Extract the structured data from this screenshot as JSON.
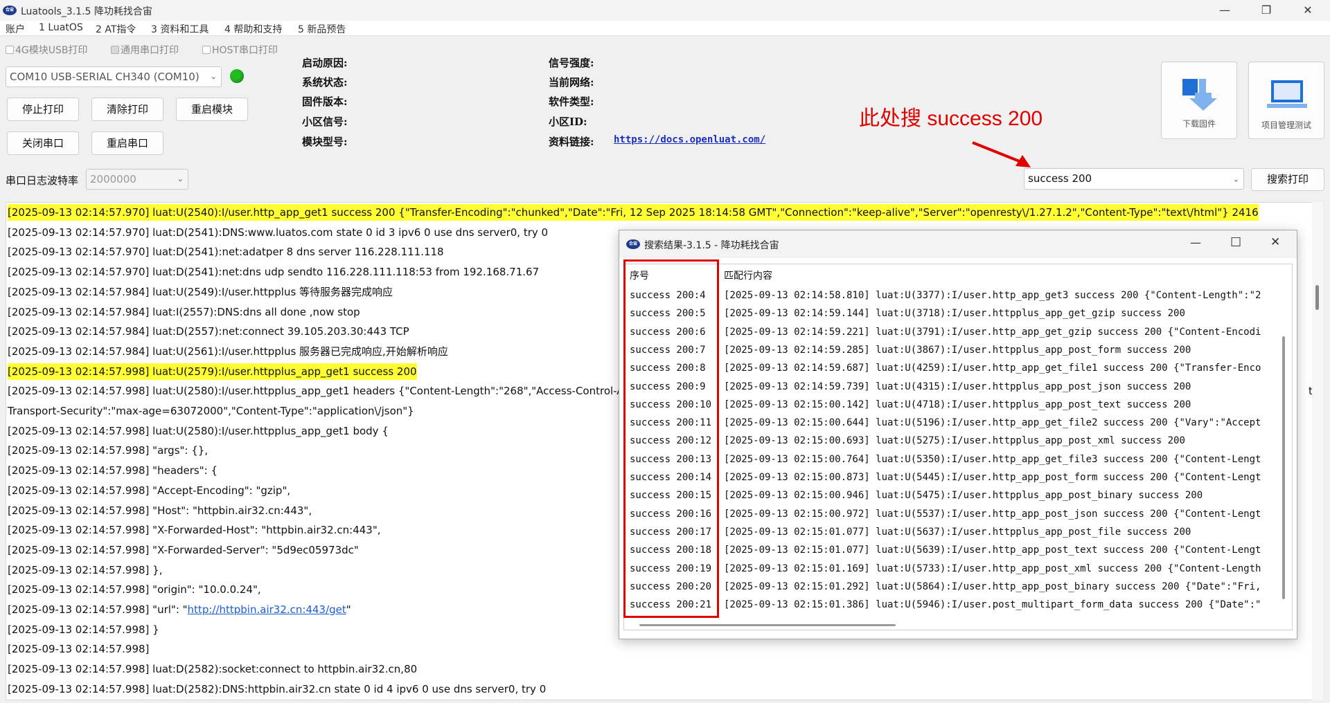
{
  "window": {
    "title": "Luatools_3.1.5 降功耗找合宙",
    "logo_text": "合宙",
    "minimize": "—",
    "maximize": "❐",
    "close": "✕"
  },
  "menu": [
    "账户",
    "1 LuatOS",
    "2 AT指令",
    "3 资料和工具",
    "4 帮助和支持",
    "5 新品预告"
  ],
  "checkboxes": [
    {
      "label": "4G模块USB打印",
      "checked": false
    },
    {
      "label": "通用串口打印",
      "checked": true
    },
    {
      "label": "HOST串口打印",
      "checked": false
    }
  ],
  "port_select": {
    "value": "COM10 USB-SERIAL CH340 (COM10)"
  },
  "status_color": "#22bb22",
  "buttons": {
    "stop_print": "停止打印",
    "clear_print": "清除打印",
    "restart_module": "重启模块",
    "close_port": "关闭串口",
    "restart_port": "重启串口",
    "download_firmware": "下载固件",
    "project_test": "项目管理测试",
    "search_print": "搜索打印"
  },
  "info": {
    "boot_reason": "启动原因:",
    "system_status": "系统状态:",
    "firmware_version": "固件版本:",
    "cell_signal": "小区信号:",
    "module_model": "模块型号:",
    "signal_strength": "信号强度:",
    "current_network": "当前网络:",
    "software_type": "软件类型:",
    "cell_id": "小区ID:",
    "doc_link_label": "资料链接:",
    "doc_link": "https://docs.openluat.com/"
  },
  "baud": {
    "label": "串口日志波特率",
    "value": "2000000"
  },
  "search": {
    "value": "success 200"
  },
  "annotation": "此处搜 success 200",
  "log_lines": [
    {
      "text": "[2025-09-13 02:14:57.970] luat:U(2540):I/user.http_app_get1 success 200 {\"Transfer-Encoding\":\"chunked\",\"Date\":\"Fri, 12 Sep 2025 18:14:58 GMT\",\"Connection\":\"keep-alive\",\"Server\":\"openresty\\/1.27.1.2\",\"Content-Type\":\"text\\/html\"} 2416",
      "hl": true
    },
    {
      "text": "[2025-09-13 02:14:57.970] luat:D(2541):DNS:www.luatos.com state 0 id 3 ipv6 0 use dns server0, try 0",
      "hl": false
    },
    {
      "text": "[2025-09-13 02:14:57.970] luat:D(2541):net:adatper 8 dns server 116.228.111.118",
      "hl": false
    },
    {
      "text": "[2025-09-13 02:14:57.970] luat:D(2541):net:dns udp sendto 116.228.111.118:53 from 192.168.71.67",
      "hl": false
    },
    {
      "text": "[2025-09-13 02:14:57.984] luat:U(2549):I/user.httpplus 等待服务器完成响应",
      "hl": false
    },
    {
      "text": "[2025-09-13 02:14:57.984] luat:I(2557):DNS:dns all done ,now stop",
      "hl": false
    },
    {
      "text": "[2025-09-13 02:14:57.984] luat:D(2557):net:connect 39.105.203.30:443 TCP",
      "hl": false
    },
    {
      "text": "[2025-09-13 02:14:57.984] luat:U(2561):I/user.httpplus 服务器已完成响应,开始解析响应",
      "hl": false
    },
    {
      "text": "[2025-09-13 02:14:57.998] luat:U(2579):I/user.httpplus_app_get1 success 200",
      "hl": true
    },
    {
      "text": "[2025-09-13 02:14:57.998] luat:U(2580):I/user.httpplus_app_get1 headers {\"Content-Length\":\"268\",\"Access-Control-Allow-O",
      "hl": false,
      "tail": "t-"
    },
    {
      "text": "Transport-Security\":\"max-age=63072000\",\"Content-Type\":\"application\\/json\"}",
      "hl": false
    },
    {
      "text": "[2025-09-13 02:14:57.998] luat:U(2580):I/user.httpplus_app_get1 body {",
      "hl": false
    },
    {
      "text": "[2025-09-13 02:14:57.998]     \"args\": {},",
      "hl": false
    },
    {
      "text": "[2025-09-13 02:14:57.998]     \"headers\": {",
      "hl": false
    },
    {
      "text": "[2025-09-13 02:14:57.998]       \"Accept-Encoding\": \"gzip\",",
      "hl": false
    },
    {
      "text": "[2025-09-13 02:14:57.998]       \"Host\": \"httpbin.air32.cn:443\",",
      "hl": false
    },
    {
      "text": "[2025-09-13 02:14:57.998]       \"X-Forwarded-Host\": \"httpbin.air32.cn:443\",",
      "hl": false
    },
    {
      "text": "[2025-09-13 02:14:57.998]       \"X-Forwarded-Server\": \"5d9ec05973dc\"",
      "hl": false
    },
    {
      "text": "[2025-09-13 02:14:57.998]     },",
      "hl": false
    },
    {
      "text": "[2025-09-13 02:14:57.998]     \"origin\": \"10.0.0.24\",",
      "hl": false
    },
    {
      "text": "[2025-09-13 02:14:57.998]     \"url\": \"",
      "hl": false,
      "link": "http://httpbin.air32.cn:443/get",
      "after": "\""
    },
    {
      "text": "[2025-09-13 02:14:57.998] }",
      "hl": false
    },
    {
      "text": "[2025-09-13 02:14:57.998]",
      "hl": false
    },
    {
      "text": "[2025-09-13 02:14:57.998] luat:D(2582):socket:connect to httpbin.air32.cn,80",
      "hl": false
    },
    {
      "text": "[2025-09-13 02:14:57.998] luat:D(2582):DNS:httpbin.air32.cn state 0 id 4 ipv6 0 use dns server0, try 0",
      "hl": false
    }
  ],
  "dialog": {
    "title": "搜索结果-3.1.5 - 降功耗找合宙",
    "minimize": "—",
    "maximize": "☐",
    "close": "✕",
    "col_seq": "序号",
    "col_content": "匹配行内容",
    "rows": [
      {
        "seq": "success 200:4",
        "content": "[2025-09-13 02:14:58.810] luat:U(3377):I/user.http_app_get3 success 200 {\"Content-Length\":\"2"
      },
      {
        "seq": "success 200:5",
        "content": "[2025-09-13 02:14:59.144] luat:U(3718):I/user.httpplus_app_get_gzip success 200"
      },
      {
        "seq": "success 200:6",
        "content": "[2025-09-13 02:14:59.221] luat:U(3791):I/user.http_app_get_gzip success 200 {\"Content-Encodi"
      },
      {
        "seq": "success 200:7",
        "content": "[2025-09-13 02:14:59.285] luat:U(3867):I/user.httpplus_app_post_form success 200"
      },
      {
        "seq": "success 200:8",
        "content": "[2025-09-13 02:14:59.687] luat:U(4259):I/user.http_app_get_file1 success 200 {\"Transfer-Enco"
      },
      {
        "seq": "success 200:9",
        "content": "[2025-09-13 02:14:59.739] luat:U(4315):I/user.httpplus_app_post_json success 200"
      },
      {
        "seq": "success 200:10",
        "content": "[2025-09-13 02:15:00.142] luat:U(4718):I/user.httpplus_app_post_text success 200"
      },
      {
        "seq": "success 200:11",
        "content": "[2025-09-13 02:15:00.644] luat:U(5196):I/user.http_app_get_file2 success 200 {\"Vary\":\"Accept"
      },
      {
        "seq": "success 200:12",
        "content": "[2025-09-13 02:15:00.693] luat:U(5275):I/user.httpplus_app_post_xml success 200"
      },
      {
        "seq": "success 200:13",
        "content": "[2025-09-13 02:15:00.764] luat:U(5350):I/user.http_app_get_file3 success 200 {\"Content-Lengt"
      },
      {
        "seq": "success 200:14",
        "content": "[2025-09-13 02:15:00.873] luat:U(5445):I/user.http_app_post_form success 200 {\"Content-Lengt"
      },
      {
        "seq": "success 200:15",
        "content": "[2025-09-13 02:15:00.946] luat:U(5475):I/user.httpplus_app_post_binary success 200"
      },
      {
        "seq": "success 200:16",
        "content": "[2025-09-13 02:15:00.972] luat:U(5537):I/user.http_app_post_json success 200 {\"Content-Lengt"
      },
      {
        "seq": "success 200:17",
        "content": "[2025-09-13 02:15:01.077] luat:U(5637):I/user.httpplus_app_post_file success 200"
      },
      {
        "seq": "success 200:18",
        "content": "[2025-09-13 02:15:01.077] luat:U(5639):I/user.http_app_post_text success 200 {\"Content-Lengt"
      },
      {
        "seq": "success 200:19",
        "content": "[2025-09-13 02:15:01.169] luat:U(5733):I/user.http_app_post_xml success 200 {\"Content-Length"
      },
      {
        "seq": "success 200:20",
        "content": "[2025-09-13 02:15:01.292] luat:U(5864):I/user.http_app_post_binary success 200 {\"Date\":\"Fri,"
      },
      {
        "seq": "success 200:21",
        "content": "[2025-09-13 02:15:01.386] luat:U(5946):I/user.post_multipart_form_data success 200 {\"Date\":\""
      }
    ]
  }
}
